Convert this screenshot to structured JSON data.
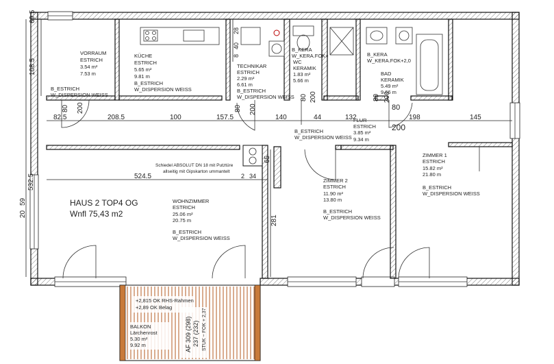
{
  "building": {
    "title": "HAUS 2 TOP4 OG",
    "area": "Wnfl 75,43 m2"
  },
  "rooms": {
    "vorraum": {
      "name": "VORRAUM",
      "floor": "ESTRICH",
      "area": "3.54 m²",
      "perimeter": "7.53 m",
      "finish1": "B_ESTRICH",
      "finish2": "W_DISPERSION WEISS"
    },
    "kueche": {
      "name": "KÜCHE",
      "floor": "ESTRICH",
      "area": "5.65 m²",
      "perimeter": "9.81 m",
      "finish1": "B_ESTRICH",
      "finish2": "W_DISPERSION WEISS"
    },
    "technik": {
      "name": "TECHNIKAR",
      "floor": "ESTRICH",
      "area": "2.29 m²",
      "perimeter": "6.61 m",
      "finish1": "B_ESTRICH",
      "finish2": "W_DISPERSION WEISS"
    },
    "wc": {
      "f1": "B_KERA",
      "f2": "W_KERA.FOK+",
      "name": "WC",
      "floor": "KERAMIK",
      "area": "1.83 m²",
      "perimeter": "5.66 m"
    },
    "bad": {
      "f1": "B_KERA",
      "f2": "W_KERA.FOK+2,0",
      "name": "BAD",
      "floor": "KERAMIK",
      "area": "5.49 m²",
      "perimeter": "9.66 m"
    },
    "flur": {
      "name": "FLUR",
      "floor": "ESTRICH",
      "area": "3.85 m²",
      "perimeter": "9.34 m",
      "finish1": "B_ESTRICH",
      "finish2": "W_DISPERSION WEISS"
    },
    "zimmer1": {
      "name": "ZIMMER 1",
      "floor": "ESTRICH",
      "area": "15.82 m²",
      "perimeter": "21.80 m",
      "finish1": "B_ESTRICH",
      "finish2": "W_DISPERSION WEISS"
    },
    "zimmer2": {
      "name": "ZIMMER 2",
      "floor": "ESTRICH",
      "area": "11.90 m²",
      "perimeter": "13.80 m",
      "finish1": "B_ESTRICH",
      "finish2": "W_DISPERSION WEISS"
    },
    "wohnzimmer": {
      "name": "WOHNZIMMER",
      "floor": "ESTRICH",
      "area": "25.06 m²",
      "perimeter": "20.75 m",
      "finish1": "B_ESTRICH",
      "finish2": "W_DISPERSION WEISS"
    },
    "balkon": {
      "name": "BALKON",
      "floor": "Lärchenrost",
      "area": "5.30 m²",
      "perimeter": "9.92 m",
      "note1": "+2,815 OK RHS-Rahmen",
      "note2": "+2,89 OK Belag"
    }
  },
  "notes": {
    "schiedel1": "Schiedel ABSOLUT DN 18 mit Putztüre",
    "schiedel2": "allseitig mit Gipskarton ummantelt",
    "af": "AF 309 (298)",
    "af2": "237 (232)",
    "stuk": "STUK ~ FOK + 2,37"
  },
  "dims": {
    "row1": [
      "82.5",
      "208.5",
      "100",
      "157.5",
      "140",
      "44",
      "132",
      "198",
      "145"
    ],
    "d80": "80",
    "d200": "200",
    "d524": "524.5",
    "d532": "532.5",
    "d108": "108.5",
    "d69": "69.5",
    "d20": "20",
    "d59": "59",
    "d65": "65",
    "d281": "281",
    "d34": "34",
    "d2": "2",
    "d28": "28",
    "d40": "40",
    "d8": "8",
    "d200b": "200",
    "d80b": "80"
  }
}
